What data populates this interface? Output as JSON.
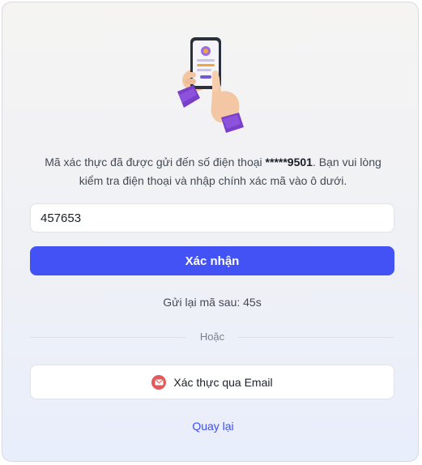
{
  "message": {
    "line1_prefix": "Mã xác thực đã được gửi đến số điện thoại ",
    "phone_masked": "*****9501",
    "line1_suffix": ". Bạn vui lòng",
    "line2": "kiểm tra điện thoại và nhập chính xác mã vào ô dưới."
  },
  "code_input": {
    "value": "457653",
    "placeholder": ""
  },
  "confirm_button": {
    "label": "Xác nhận"
  },
  "resend": {
    "text": "Gửi lại mã sau: 45s",
    "seconds": 45
  },
  "divider": {
    "text": "Hoặc"
  },
  "email_button": {
    "label": "Xác thực qua Email",
    "icon": "mail-icon"
  },
  "back_link": {
    "label": "Quay lại"
  },
  "colors": {
    "primary": "#4352f5",
    "link": "#3d4ef0",
    "mail_icon": "#e35a5a",
    "sleeve": "#7a3fc9",
    "hand": "#f3c7a3"
  }
}
